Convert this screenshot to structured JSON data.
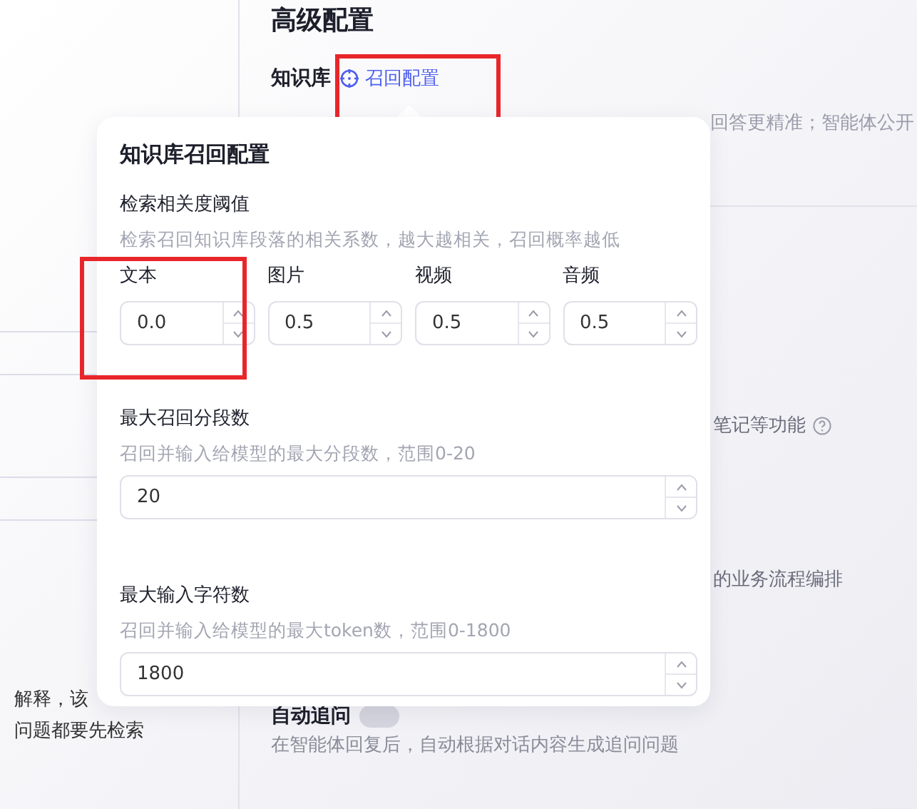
{
  "sidebar": {
    "text_lines": [
      "解释，该",
      "问题都要先检索"
    ]
  },
  "main": {
    "title": "高级配置",
    "knowledge": {
      "label": "知识库",
      "recall_link": "召回配置",
      "description_tail": "回答更精准；智能体公开"
    },
    "fragments": [
      {
        "text": "笔记等功能",
        "help": true
      },
      {
        "text": "的业务流程编排",
        "help": false
      }
    ],
    "follow_up": {
      "label": "自动追问",
      "on": false,
      "description": "在智能体回复后，自动根据对话内容生成追问问题"
    }
  },
  "popover": {
    "title": "知识库召回配置",
    "threshold": {
      "label": "检索相关度阈值",
      "hint": "检索召回知识库段落的相关系数，越大越相关，召回概率越低",
      "fields": [
        {
          "label": "文本",
          "value": "0.0"
        },
        {
          "label": "图片",
          "value": "0.5"
        },
        {
          "label": "视频",
          "value": "0.5"
        },
        {
          "label": "音频",
          "value": "0.5"
        }
      ]
    },
    "settings": [
      {
        "label": "最大召回分段数",
        "hint": "召回并输入给模型的最大分段数，范围0-20",
        "value": "20"
      },
      {
        "label": "最大输入字符数",
        "hint": "召回并输入给模型的最大token数，范围0-1800",
        "value": "1800"
      }
    ]
  }
}
